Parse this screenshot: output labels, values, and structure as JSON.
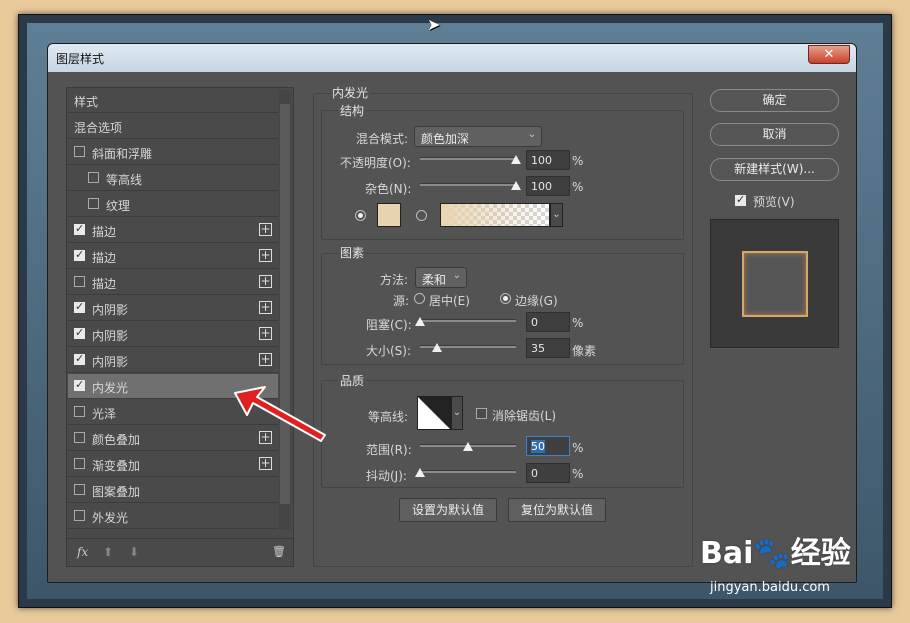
{
  "window": {
    "title": "图层样式",
    "close_label": "✕"
  },
  "layer_list": {
    "items": [
      {
        "label": "样式",
        "checkbox": false,
        "checked": false,
        "plus": false,
        "indent": 0
      },
      {
        "label": "混合选项",
        "checkbox": false,
        "checked": false,
        "plus": false,
        "indent": 0
      },
      {
        "label": "斜面和浮雕",
        "checkbox": true,
        "checked": false,
        "plus": false,
        "indent": 0
      },
      {
        "label": "等高线",
        "checkbox": true,
        "checked": false,
        "plus": false,
        "indent": 1
      },
      {
        "label": "纹理",
        "checkbox": true,
        "checked": false,
        "plus": false,
        "indent": 1
      },
      {
        "label": "描边",
        "checkbox": true,
        "checked": true,
        "plus": true,
        "indent": 0
      },
      {
        "label": "描边",
        "checkbox": true,
        "checked": true,
        "plus": true,
        "indent": 0
      },
      {
        "label": "描边",
        "checkbox": true,
        "checked": false,
        "plus": true,
        "indent": 0
      },
      {
        "label": "内阴影",
        "checkbox": true,
        "checked": true,
        "plus": true,
        "indent": 0
      },
      {
        "label": "内阴影",
        "checkbox": true,
        "checked": true,
        "plus": true,
        "indent": 0
      },
      {
        "label": "内阴影",
        "checkbox": true,
        "checked": true,
        "plus": true,
        "indent": 0
      },
      {
        "label": "内发光",
        "checkbox": true,
        "checked": true,
        "plus": false,
        "indent": 0,
        "selected": true
      },
      {
        "label": "光泽",
        "checkbox": true,
        "checked": false,
        "plus": false,
        "indent": 0
      },
      {
        "label": "颜色叠加",
        "checkbox": true,
        "checked": false,
        "plus": true,
        "indent": 0
      },
      {
        "label": "渐变叠加",
        "checkbox": true,
        "checked": false,
        "plus": true,
        "indent": 0
      },
      {
        "label": "图案叠加",
        "checkbox": true,
        "checked": false,
        "plus": false,
        "indent": 0
      },
      {
        "label": "外发光",
        "checkbox": true,
        "checked": false,
        "plus": false,
        "indent": 0
      }
    ],
    "footer": {
      "fx": "fx",
      "up": "⬆",
      "down": "⬇",
      "trash": "🗑"
    }
  },
  "inner_glow": {
    "section_title": "内发光",
    "structure": {
      "title": "结构",
      "blend_mode_label": "混合模式:",
      "blend_mode_value": "颜色加深",
      "opacity_label": "不透明度(O):",
      "opacity_value": "100",
      "opacity_fraction": 1.0,
      "noise_label": "杂色(N):",
      "noise_value": "100",
      "noise_fraction": 1.0,
      "percent": "%",
      "color_swatch": "#e8d4b0"
    },
    "elements": {
      "title": "图素",
      "technique_label": "方法:",
      "technique_value": "柔和",
      "source_label": "源:",
      "source_center": "居中(E)",
      "source_edge": "边缘(G)",
      "choke_label": "阻塞(C):",
      "choke_value": "0",
      "choke_fraction": 0.0,
      "size_label": "大小(S):",
      "size_value": "35",
      "size_fraction": 0.18,
      "size_unit": "像素"
    },
    "quality": {
      "title": "品质",
      "contour_label": "等高线:",
      "antialias_label": "消除锯齿(L)",
      "range_label": "范围(R):",
      "range_value": "50",
      "range_fraction": 0.5,
      "jitter_label": "抖动(J):",
      "jitter_value": "0",
      "jitter_fraction": 0.0
    },
    "set_default": "设置为默认值",
    "reset_default": "复位为默认值"
  },
  "actions": {
    "ok": "确定",
    "cancel": "取消",
    "new_style": "新建样式(W)...",
    "preview_label": "预览(V)",
    "preview_checked": true
  },
  "watermark": {
    "brand": "Bai🐾经验",
    "url": "jingyan.baidu.com"
  },
  "colors": {
    "accent": "#3c82c9",
    "arrow": "#e02020",
    "glow": "#d4a86a"
  }
}
